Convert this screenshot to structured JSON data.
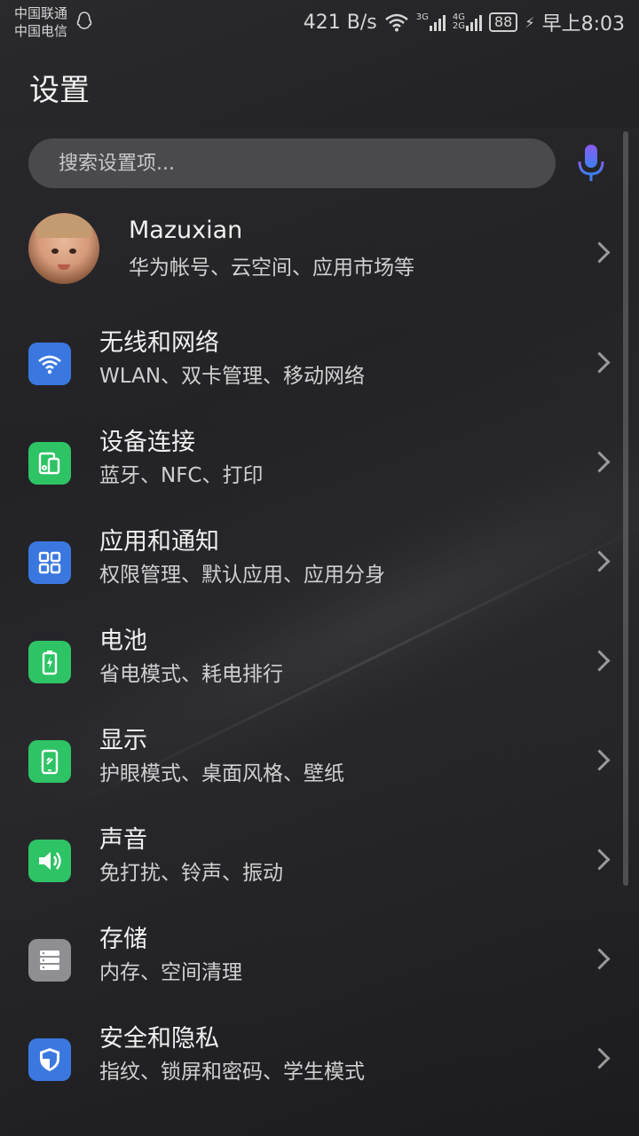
{
  "status_bar": {
    "carrier1": "中国联通",
    "carrier2": "中国电信",
    "net_speed": "421 B/s",
    "net1": "3G",
    "net2_top": "4G",
    "net2_bottom": "2G",
    "battery": "88",
    "time": "早上8:03"
  },
  "page": {
    "title": "设置"
  },
  "search": {
    "placeholder": "搜索设置项..."
  },
  "profile": {
    "name": "Mazuxian",
    "subtitle": "华为帐号、云空间、应用市场等"
  },
  "colors": {
    "blue": "#3a78e0",
    "green": "#2ec365",
    "gray": "#8e8e93"
  },
  "items": [
    {
      "title": "无线和网络",
      "subtitle": "WLAN、双卡管理、移动网络",
      "icon": "wifi-icon"
    },
    {
      "title": "设备连接",
      "subtitle": "蓝牙、NFC、打印",
      "icon": "device-connect-icon"
    },
    {
      "title": "应用和通知",
      "subtitle": "权限管理、默认应用、应用分身",
      "icon": "apps-grid-icon"
    },
    {
      "title": "电池",
      "subtitle": "省电模式、耗电排行",
      "icon": "battery-icon"
    },
    {
      "title": "显示",
      "subtitle": "护眼模式、桌面风格、壁纸",
      "icon": "display-icon"
    },
    {
      "title": "声音",
      "subtitle": "免打扰、铃声、振动",
      "icon": "speaker-icon"
    },
    {
      "title": "存储",
      "subtitle": "内存、空间清理",
      "icon": "storage-icon"
    },
    {
      "title": "安全和隐私",
      "subtitle": "指纹、锁屏和密码、学生模式",
      "icon": "shield-icon"
    }
  ]
}
